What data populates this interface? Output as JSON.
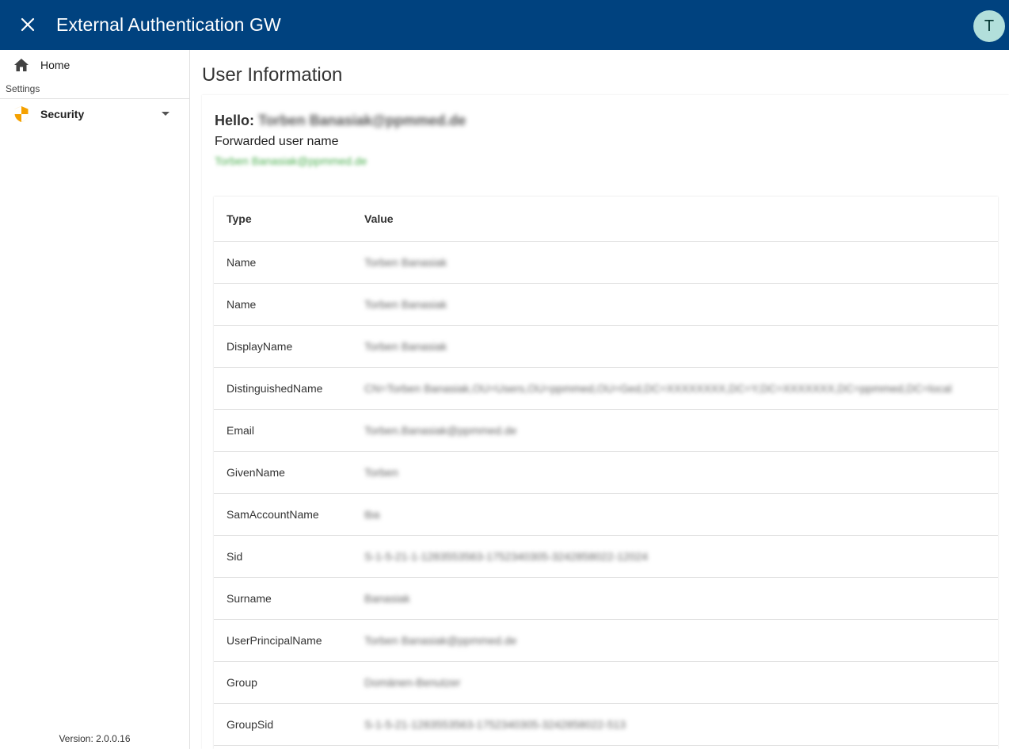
{
  "appbar": {
    "title": "External Authentication GW",
    "avatar_initial": "T",
    "bg_color": "#00427f"
  },
  "sidebar": {
    "home_label": "Home",
    "section_label": "Settings",
    "security_label": "Security",
    "version": "Version: 2.0.0.16"
  },
  "page": {
    "title": "User Information",
    "hello_prefix": "Hello:",
    "hello_user": "Torben Banasiak@ppmmed.de",
    "forwarded_label": "Forwarded user name",
    "forwarded_value": "Torben Banasiak@ppmmed.de"
  },
  "table": {
    "headers": [
      "Type",
      "Value"
    ],
    "rows": [
      {
        "type": "Name",
        "value": "Torben Banasiak"
      },
      {
        "type": "Name",
        "value": "Torben Banasiak"
      },
      {
        "type": "DisplayName",
        "value": "Torben Banasiak"
      },
      {
        "type": "DistinguishedName",
        "value": "CN=Torben Banasiak,OU=Users,OU=ppmmed,OU=Ged,DC=XXXXXXXX,DC=Y,DC=XXXXXXX,DC=ppmmed,DC=local"
      },
      {
        "type": "Email",
        "value": "Torben.Banasiak@ppmmed.de"
      },
      {
        "type": "GivenName",
        "value": "Torben"
      },
      {
        "type": "SamAccountName",
        "value": "tba"
      },
      {
        "type": "Sid",
        "value": "S-1-5-21-1-1283553563-1752340305-3242858022-12024"
      },
      {
        "type": "Surname",
        "value": "Banasiak"
      },
      {
        "type": "UserPrincipalName",
        "value": "Torben Banasiak@ppmmed.de"
      },
      {
        "type": "Group",
        "value": "Domänen-Benutzer"
      },
      {
        "type": "GroupSid",
        "value": "S-1-5-21-1283553563-1752340305-3242858022-513"
      }
    ]
  }
}
